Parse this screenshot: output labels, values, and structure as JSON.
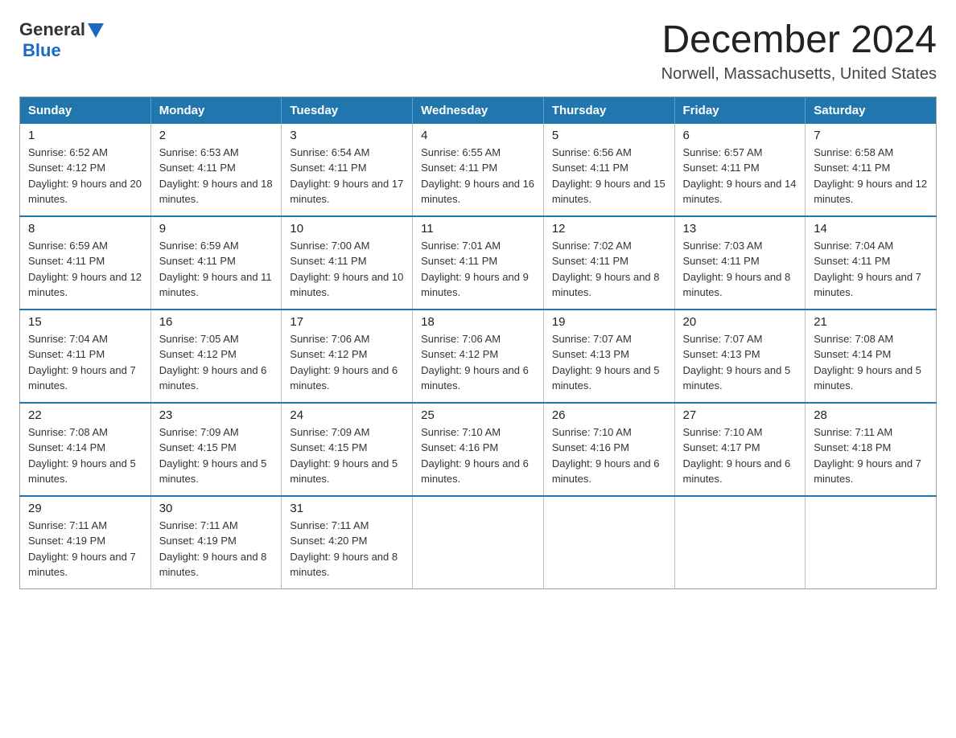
{
  "header": {
    "logo_general": "General",
    "logo_blue": "Blue",
    "month_title": "December 2024",
    "location": "Norwell, Massachusetts, United States"
  },
  "weekdays": [
    "Sunday",
    "Monday",
    "Tuesday",
    "Wednesday",
    "Thursday",
    "Friday",
    "Saturday"
  ],
  "weeks": [
    [
      {
        "day": "1",
        "sunrise": "6:52 AM",
        "sunset": "4:12 PM",
        "daylight": "9 hours and 20 minutes."
      },
      {
        "day": "2",
        "sunrise": "6:53 AM",
        "sunset": "4:11 PM",
        "daylight": "9 hours and 18 minutes."
      },
      {
        "day": "3",
        "sunrise": "6:54 AM",
        "sunset": "4:11 PM",
        "daylight": "9 hours and 17 minutes."
      },
      {
        "day": "4",
        "sunrise": "6:55 AM",
        "sunset": "4:11 PM",
        "daylight": "9 hours and 16 minutes."
      },
      {
        "day": "5",
        "sunrise": "6:56 AM",
        "sunset": "4:11 PM",
        "daylight": "9 hours and 15 minutes."
      },
      {
        "day": "6",
        "sunrise": "6:57 AM",
        "sunset": "4:11 PM",
        "daylight": "9 hours and 14 minutes."
      },
      {
        "day": "7",
        "sunrise": "6:58 AM",
        "sunset": "4:11 PM",
        "daylight": "9 hours and 12 minutes."
      }
    ],
    [
      {
        "day": "8",
        "sunrise": "6:59 AM",
        "sunset": "4:11 PM",
        "daylight": "9 hours and 12 minutes."
      },
      {
        "day": "9",
        "sunrise": "6:59 AM",
        "sunset": "4:11 PM",
        "daylight": "9 hours and 11 minutes."
      },
      {
        "day": "10",
        "sunrise": "7:00 AM",
        "sunset": "4:11 PM",
        "daylight": "9 hours and 10 minutes."
      },
      {
        "day": "11",
        "sunrise": "7:01 AM",
        "sunset": "4:11 PM",
        "daylight": "9 hours and 9 minutes."
      },
      {
        "day": "12",
        "sunrise": "7:02 AM",
        "sunset": "4:11 PM",
        "daylight": "9 hours and 8 minutes."
      },
      {
        "day": "13",
        "sunrise": "7:03 AM",
        "sunset": "4:11 PM",
        "daylight": "9 hours and 8 minutes."
      },
      {
        "day": "14",
        "sunrise": "7:04 AM",
        "sunset": "4:11 PM",
        "daylight": "9 hours and 7 minutes."
      }
    ],
    [
      {
        "day": "15",
        "sunrise": "7:04 AM",
        "sunset": "4:11 PM",
        "daylight": "9 hours and 7 minutes."
      },
      {
        "day": "16",
        "sunrise": "7:05 AM",
        "sunset": "4:12 PM",
        "daylight": "9 hours and 6 minutes."
      },
      {
        "day": "17",
        "sunrise": "7:06 AM",
        "sunset": "4:12 PM",
        "daylight": "9 hours and 6 minutes."
      },
      {
        "day": "18",
        "sunrise": "7:06 AM",
        "sunset": "4:12 PM",
        "daylight": "9 hours and 6 minutes."
      },
      {
        "day": "19",
        "sunrise": "7:07 AM",
        "sunset": "4:13 PM",
        "daylight": "9 hours and 5 minutes."
      },
      {
        "day": "20",
        "sunrise": "7:07 AM",
        "sunset": "4:13 PM",
        "daylight": "9 hours and 5 minutes."
      },
      {
        "day": "21",
        "sunrise": "7:08 AM",
        "sunset": "4:14 PM",
        "daylight": "9 hours and 5 minutes."
      }
    ],
    [
      {
        "day": "22",
        "sunrise": "7:08 AM",
        "sunset": "4:14 PM",
        "daylight": "9 hours and 5 minutes."
      },
      {
        "day": "23",
        "sunrise": "7:09 AM",
        "sunset": "4:15 PM",
        "daylight": "9 hours and 5 minutes."
      },
      {
        "day": "24",
        "sunrise": "7:09 AM",
        "sunset": "4:15 PM",
        "daylight": "9 hours and 5 minutes."
      },
      {
        "day": "25",
        "sunrise": "7:10 AM",
        "sunset": "4:16 PM",
        "daylight": "9 hours and 6 minutes."
      },
      {
        "day": "26",
        "sunrise": "7:10 AM",
        "sunset": "4:16 PM",
        "daylight": "9 hours and 6 minutes."
      },
      {
        "day": "27",
        "sunrise": "7:10 AM",
        "sunset": "4:17 PM",
        "daylight": "9 hours and 6 minutes."
      },
      {
        "day": "28",
        "sunrise": "7:11 AM",
        "sunset": "4:18 PM",
        "daylight": "9 hours and 7 minutes."
      }
    ],
    [
      {
        "day": "29",
        "sunrise": "7:11 AM",
        "sunset": "4:19 PM",
        "daylight": "9 hours and 7 minutes."
      },
      {
        "day": "30",
        "sunrise": "7:11 AM",
        "sunset": "4:19 PM",
        "daylight": "9 hours and 8 minutes."
      },
      {
        "day": "31",
        "sunrise": "7:11 AM",
        "sunset": "4:20 PM",
        "daylight": "9 hours and 8 minutes."
      },
      null,
      null,
      null,
      null
    ]
  ]
}
